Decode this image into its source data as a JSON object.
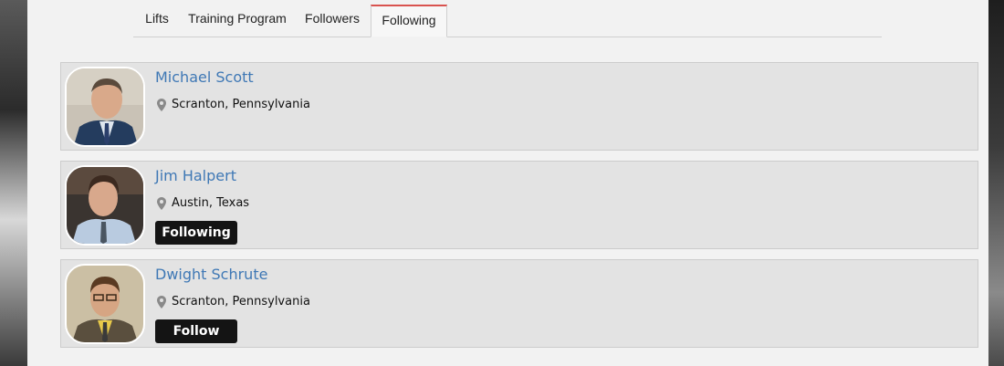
{
  "tabs": [
    {
      "label": "Lifts",
      "active": false
    },
    {
      "label": "Training Program",
      "active": false
    },
    {
      "label": "Followers",
      "active": false
    },
    {
      "label": "Following",
      "active": true
    }
  ],
  "colors": {
    "accent_tab_border": "#d9534f",
    "name_link": "#3f78b5",
    "button_bg": "#141414",
    "card_bg": "#e3e3e3"
  },
  "people": [
    {
      "name": "Michael Scott",
      "location": "Scranton, Pennsylvania",
      "location_icon": "map-pin-icon",
      "button": null
    },
    {
      "name": "Jim Halpert",
      "location": "Austin, Texas",
      "location_icon": "map-pin-icon",
      "button": "Following"
    },
    {
      "name": "Dwight Schrute",
      "location": "Scranton, Pennsylvania",
      "location_icon": "map-pin-icon",
      "button": "Follow"
    }
  ]
}
